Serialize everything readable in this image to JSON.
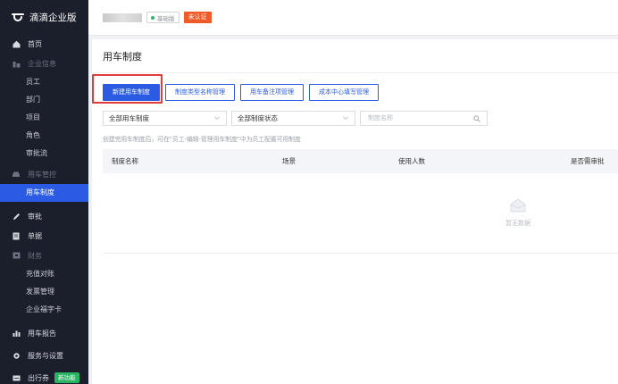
{
  "brand": {
    "name": "滴滴企业版"
  },
  "sidebar": {
    "home": "首页",
    "enterprise": "企业信息",
    "enterprise_items": [
      "员工",
      "部门",
      "项目",
      "角色",
      "审批流"
    ],
    "car_mgmt": "用车管控",
    "car_items": [
      "用车制度"
    ],
    "approval": "审批",
    "bills": "单据",
    "finance": "财务",
    "finance_items": [
      "充值对账",
      "发票管理",
      "企业福字卡"
    ],
    "report": "用车报告",
    "service": "服务与设置",
    "trip": "出行券",
    "trip_badge": "新功能"
  },
  "topbar": {
    "tag_basic": "基础版",
    "tag_unverified": "未认证"
  },
  "main": {
    "title": "用车制度",
    "buttons": [
      "新建用车制度",
      "制度类型名称管理",
      "用车备注项管理",
      "成本中心填写管理"
    ],
    "filter_rule": "全部用车制度",
    "filter_status": "全部制度状态",
    "search_placeholder": "制度名称",
    "hint": "创建完用车制度后，可在\"员工-编辑-管理用车制度\"中为员工配置可用制度",
    "columns": [
      "制度名称",
      "场景",
      "使用人数",
      "是否需审批"
    ],
    "empty_text": "暂无数据"
  },
  "colors": {
    "sidebar_bg": "#1b1e2b",
    "accent": "#2b5be3",
    "unverified": "#f05a28",
    "new_badge": "#28b463",
    "highlight": "#e23b3b"
  }
}
